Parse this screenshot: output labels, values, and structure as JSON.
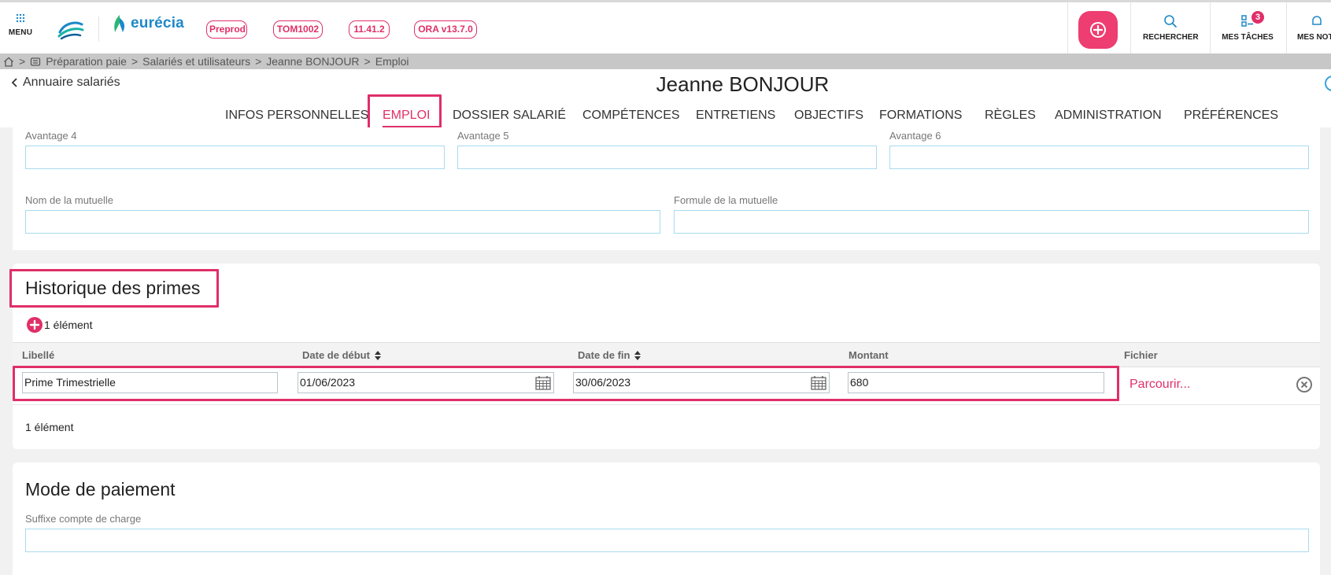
{
  "topbar": {
    "menu_label": "MENU",
    "brand_name": "eurécia",
    "env_badges": [
      "Preprod",
      "TOM1002",
      "11.41.2",
      "ORA v13.7.0"
    ],
    "search_label": "RECHERCHER",
    "tasks_label": "MES TÂCHES",
    "tasks_count": "3",
    "notifications_label": "MES NOT"
  },
  "breadcrumb": {
    "separator": ">",
    "items": [
      "Préparation paie",
      "Salariés et utilisateurs",
      "Jeanne BONJOUR",
      "Emploi"
    ]
  },
  "header": {
    "back_label": "Annuaire salariés",
    "person_name": "Jeanne BONJOUR"
  },
  "tabs": [
    {
      "label": "INFOS PERSONNELLES",
      "active": false
    },
    {
      "label": "EMPLOI",
      "active": true
    },
    {
      "label": "DOSSIER SALARIÉ",
      "active": false
    },
    {
      "label": "COMPÉTENCES",
      "active": false
    },
    {
      "label": "ENTRETIENS",
      "active": false
    },
    {
      "label": "OBJECTIFS",
      "active": false
    },
    {
      "label": "FORMATIONS",
      "active": false
    },
    {
      "label": "RÈGLES",
      "active": false
    },
    {
      "label": "ADMINISTRATION",
      "active": false
    },
    {
      "label": "PRÉFÉRENCES",
      "active": false
    }
  ],
  "benefits": {
    "avantage4_label": "Avantage 4",
    "avantage5_label": "Avantage 5",
    "avantage6_label": "Avantage 6",
    "avantage4_value": "",
    "avantage5_value": "",
    "avantage6_value": "",
    "mutuelle_name_label": "Nom de la mutuelle",
    "mutuelle_formula_label": "Formule de la mutuelle",
    "mutuelle_name_value": "",
    "mutuelle_formula_value": ""
  },
  "primes": {
    "title": "Historique des primes",
    "count_top": "1 élément",
    "count_bottom": "1 élément",
    "columns": [
      "Libellé",
      "Date de début",
      "Date de fin",
      "Montant",
      "Fichier"
    ],
    "rows": [
      {
        "libelle": "Prime Trimestrielle",
        "date_debut": "01/06/2023",
        "date_fin": "30/06/2023",
        "montant": "680",
        "fichier": "Parcourir..."
      }
    ]
  },
  "payment": {
    "title": "Mode de paiement",
    "suffix_label": "Suffixe compte de charge",
    "suffix_value": ""
  },
  "colors": {
    "accent": "#e02f68",
    "add_button": "#ee3d70",
    "brand_blue": "#1e88c8",
    "input_border": "#a9dbef"
  }
}
